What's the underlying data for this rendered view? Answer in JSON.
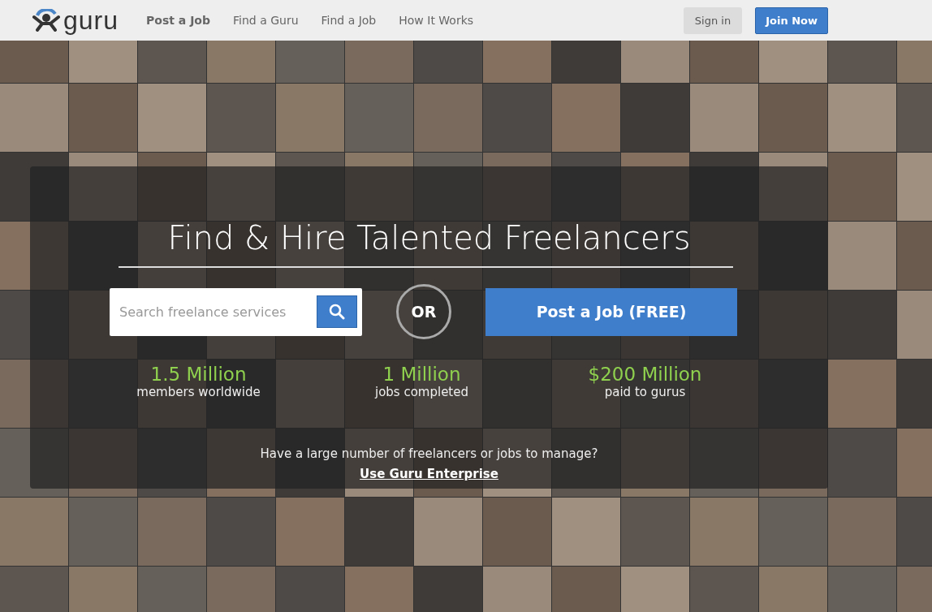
{
  "header": {
    "logo": "guru",
    "nav": [
      {
        "label": "Post a Job",
        "selected": true
      },
      {
        "label": "Find a Guru",
        "selected": false
      },
      {
        "label": "Find a Job",
        "selected": false
      },
      {
        "label": "How It Works",
        "selected": false
      }
    ],
    "sign_in": "Sign in",
    "join": "Join Now"
  },
  "hero": {
    "title": "Find & Hire Talented Freelancers",
    "search": {
      "placeholder": "Search freelance services"
    },
    "or": "OR",
    "post_button": "Post a Job (FREE)",
    "stats": [
      {
        "value": "1.5 Million",
        "label": "members worldwide"
      },
      {
        "value": "1 Million",
        "label": "jobs completed"
      },
      {
        "value": "$200 Million",
        "label": "paid to gurus"
      }
    ],
    "enterprise_text": "Have a large number of freelancers or jobs to manage?",
    "enterprise_link": "Use Guru Enterprise"
  }
}
